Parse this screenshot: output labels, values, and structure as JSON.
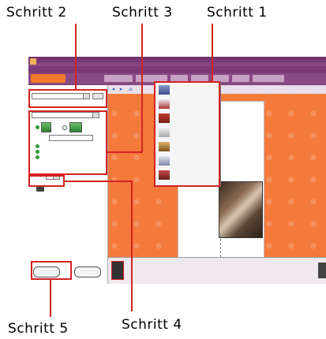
{
  "callouts": {
    "step2": "Schritt 2",
    "step3": "Schritt 3",
    "step1": "Schritt 1",
    "step5": "Schritt 5",
    "step4": "Schritt 4"
  },
  "colors": {
    "highlight": "#d42222",
    "app_purple": "#7b3c78",
    "workspace_orange": "#f47a3c"
  },
  "popup_icons": [
    "poster-icon",
    "calendar-icon",
    "frame-icon",
    "tshirt-icon",
    "card-icon",
    "sticker-icon",
    "mug-icon"
  ]
}
